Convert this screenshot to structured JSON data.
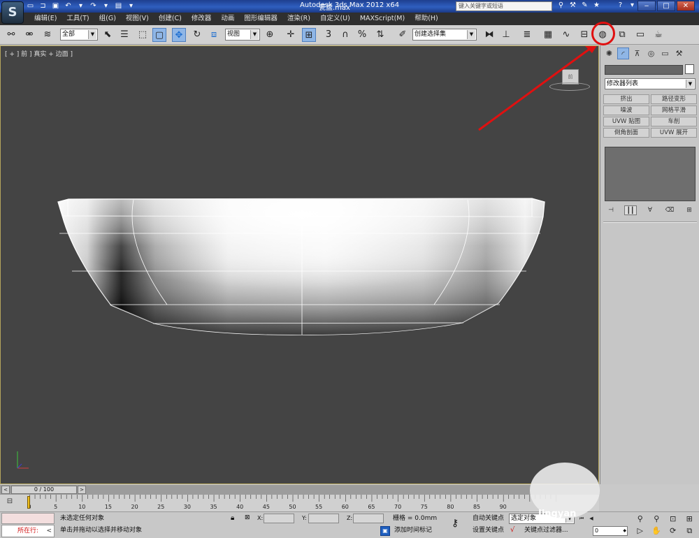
{
  "window": {
    "title": "Autodesk 3ds Max  2012 x64",
    "file_name": "瓷盆.max",
    "search_placeholder": "键入关键字或短语",
    "minimize": "‒",
    "maximize": "□",
    "close": "✕"
  },
  "menus": [
    "编辑(E)",
    "工具(T)",
    "组(G)",
    "视图(V)",
    "创建(C)",
    "修改器",
    "动画",
    "图形编辑器",
    "渲染(R)",
    "自定义(U)",
    "MAXScript(M)",
    "帮助(H)"
  ],
  "toolbar": {
    "selection_filter": "全部",
    "reference_coord": "视图",
    "snap_3": "3",
    "named_selection": "创建选择集"
  },
  "viewport": {
    "label": "[ + ] 前 ] 真实 + 边面 ]",
    "viewcube_label": "前"
  },
  "command_panel": {
    "modifier_list": "修改器列表",
    "modifier_buttons": [
      "挤出",
      "路径变形",
      "噪波",
      "网格平滑",
      "UVW 贴图",
      "车削",
      "倒角剖面",
      "UVW 展开"
    ]
  },
  "timeline": {
    "position": "0 / 100",
    "current_frame": 0,
    "total_frames": 100,
    "ticks": [
      "0",
      "5",
      "10",
      "15",
      "20",
      "25",
      "30",
      "35",
      "40",
      "45",
      "50",
      "55",
      "60",
      "65",
      "70",
      "75",
      "80",
      "85",
      "90"
    ]
  },
  "status": {
    "running": "所在行:",
    "line1": "未选定任何对象",
    "line2": "单击并拖动以选择并移动对象",
    "x_label": "X:",
    "y_label": "Y:",
    "z_label": "Z:",
    "grid": "栅格 = 0.0mm",
    "add_time_tag": "添加时间标记",
    "auto_key": "自动关键点",
    "set_key": "设置关键点",
    "selected_object": "选定对象",
    "key_filters": "关键点过滤器...",
    "frame": "0"
  },
  "watermark": "Jingyan",
  "colors": {
    "viewport_bg": "#444444",
    "highlight": "#e01010",
    "titlebar": "#2f5fbf"
  }
}
